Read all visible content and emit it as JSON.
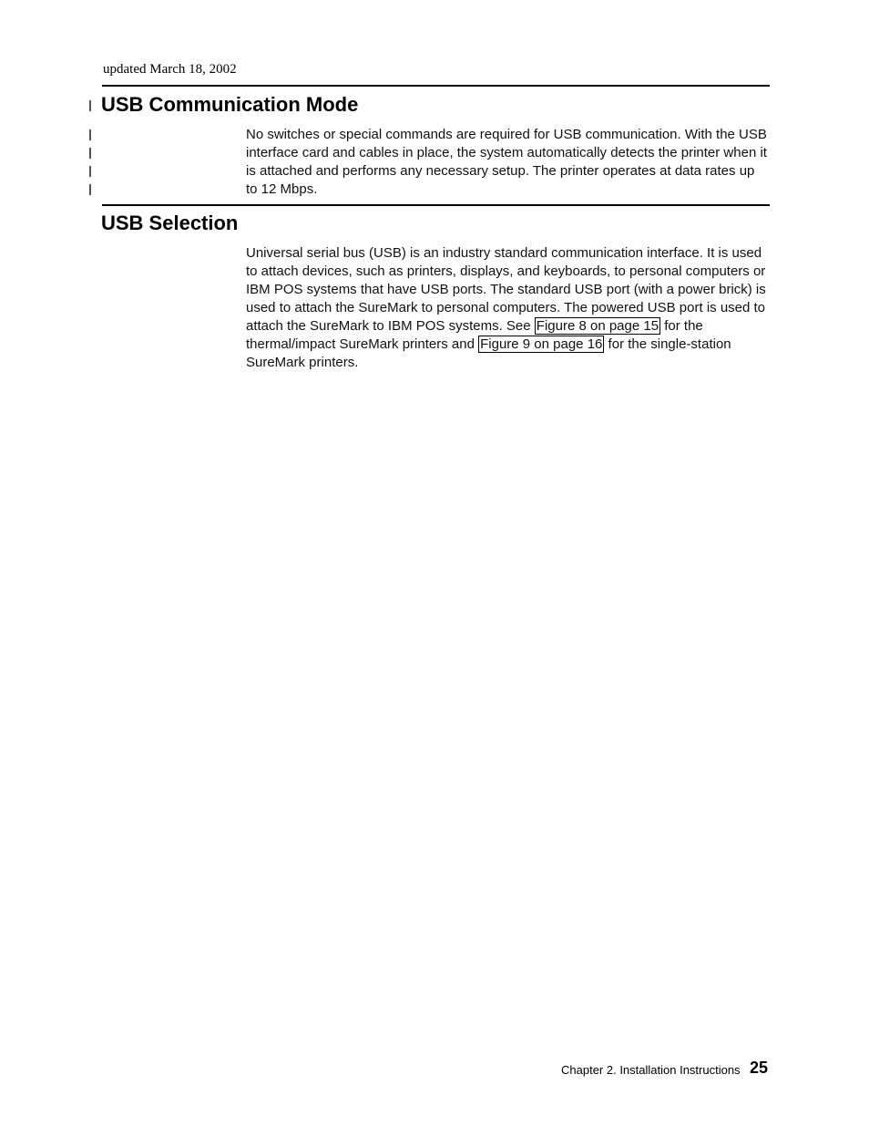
{
  "header": {
    "updated": "updated March 18, 2002"
  },
  "sections": {
    "usb_comm_mode": {
      "title": "USB Communication Mode",
      "body": "No switches or special commands are required for USB communication. With the USB interface card and cables in place, the system automatically detects the printer when it is attached and performs any necessary setup. The printer operates at data rates up to 12 Mbps."
    },
    "usb_selection": {
      "title": "USB Selection",
      "body_pre": "Universal serial bus (USB) is an industry standard communication interface. It is used to attach devices, such as printers, displays, and keyboards, to personal computers or IBM POS systems that have USB ports. The standard USB port (with a power brick) is used to attach the SureMark to personal computers. The powered USB port is used to attach the SureMark to IBM POS systems. See ",
      "xref1": "Figure 8 on page 15",
      "body_mid": " for the thermal/impact SureMark printers and ",
      "xref2": "Figure 9 on page 16",
      "body_post": " for the single-station SureMark printers."
    }
  },
  "footer": {
    "chapter": "Chapter 2. Installation Instructions",
    "page": "25"
  }
}
